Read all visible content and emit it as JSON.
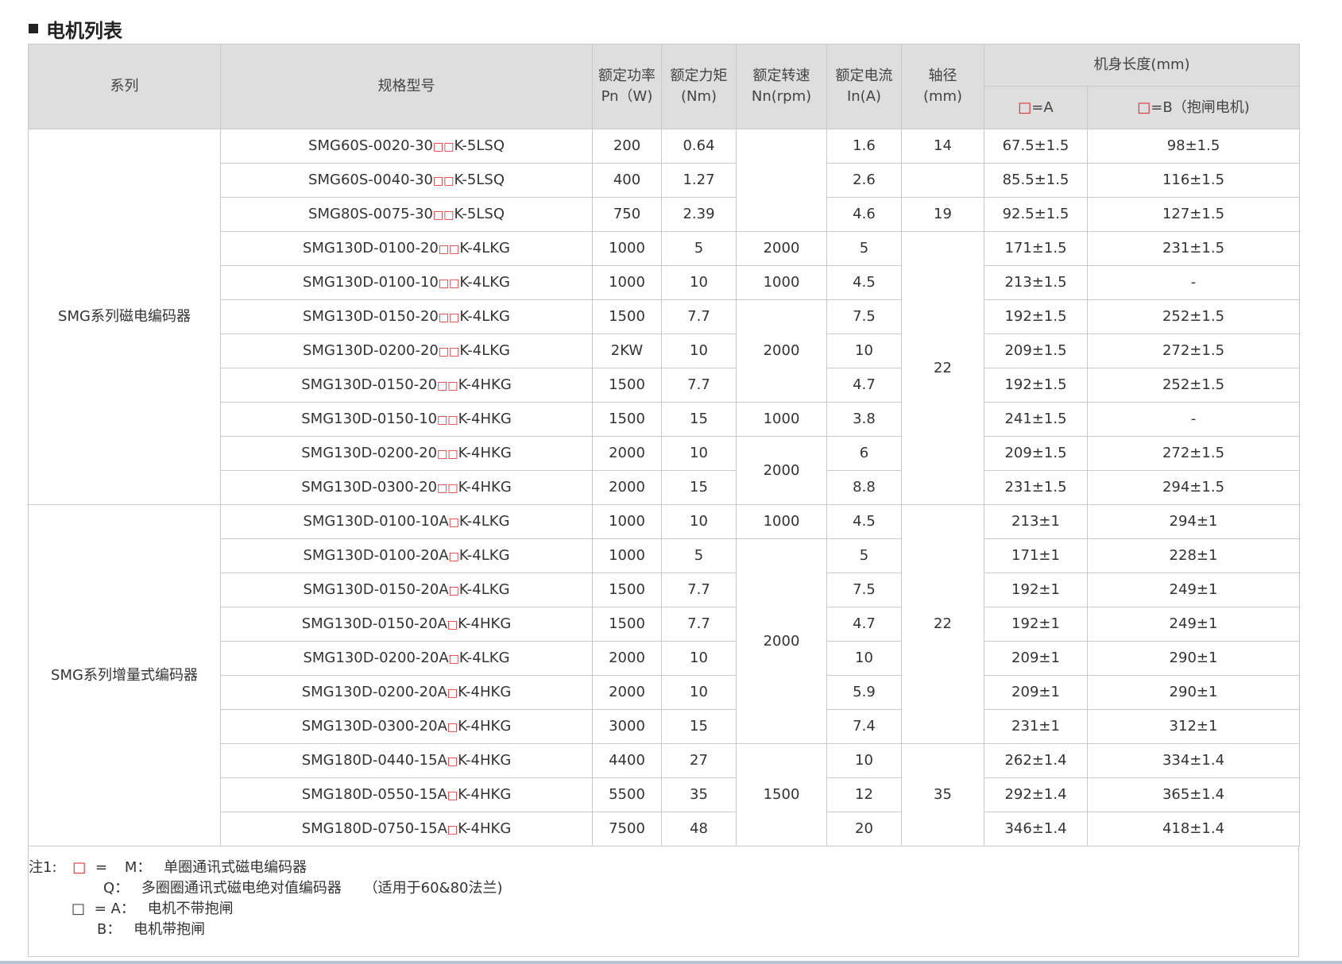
{
  "title": "电机列表",
  "headers": {
    "series": "系列",
    "model": "规格型号",
    "power": [
      "额定功率",
      "Pn（W)"
    ],
    "torque": [
      "额定力矩",
      "(Nm)"
    ],
    "speed": [
      "额定转速",
      "Nn(rpm)"
    ],
    "current": [
      "额定电流",
      "In(A)"
    ],
    "shaft": [
      "轴径",
      "(mm)"
    ],
    "length": "机身长度(mm)",
    "len_a_mark": "□",
    "len_a_label": "=A",
    "len_b_mark": "□",
    "len_b_label": "=B（抱闸电机)"
  },
  "groups": {
    "magnetic": "SMG系列磁电编码器",
    "incremental": "SMG系列增量式编码器"
  },
  "rows": [
    {
      "model": "SMG60S-0020-30□□K-5LSQ",
      "power": "200",
      "torque": "0.64",
      "speed": "",
      "current": "1.6",
      "shaft": "14",
      "len_a": "67.5±1.5",
      "len_b": "98±1.5"
    },
    {
      "model": "SMG60S-0040-30□□K-5LSQ",
      "power": "400",
      "torque": "1.27",
      "speed": "",
      "current": "2.6",
      "shaft": "",
      "len_a": "85.5±1.5",
      "len_b": "116±1.5"
    },
    {
      "model": "SMG80S-0075-30□□K-5LSQ",
      "power": "750",
      "torque": "2.39",
      "speed": "",
      "current": "4.6",
      "shaft": "19",
      "len_a": "92.5±1.5",
      "len_b": "127±1.5"
    },
    {
      "model": "SMG130D-0100-20□□K-4LKG",
      "power": "1000",
      "torque": "5",
      "speed": "2000",
      "current": "5",
      "shaft": "22",
      "len_a": "171±1.5",
      "len_b": "231±1.5"
    },
    {
      "model": "SMG130D-0100-10□□K-4LKG",
      "power": "1000",
      "torque": "10",
      "speed": "1000",
      "current": "4.5",
      "len_a": "213±1.5",
      "len_b": "-"
    },
    {
      "model": "SMG130D-0150-20□□K-4LKG",
      "power": "1500",
      "torque": "7.7",
      "speed": "2000",
      "current": "7.5",
      "len_a": "192±1.5",
      "len_b": "252±1.5"
    },
    {
      "model": "SMG130D-0200-20□□K-4LKG",
      "power": "2KW",
      "torque": "10",
      "current": "10",
      "len_a": "209±1.5",
      "len_b": "272±1.5"
    },
    {
      "model": "SMG130D-0150-20□□K-4HKG",
      "power": "1500",
      "torque": "7.7",
      "current": "4.7",
      "len_a": "192±1.5",
      "len_b": "252±1.5"
    },
    {
      "model": "SMG130D-0150-10□□K-4HKG",
      "power": "1500",
      "torque": "15",
      "speed": "1000",
      "current": "3.8",
      "len_a": "241±1.5",
      "len_b": "-"
    },
    {
      "model": "SMG130D-0200-20□□K-4HKG",
      "power": "2000",
      "torque": "10",
      "speed": "2000",
      "current": "6",
      "len_a": "209±1.5",
      "len_b": "272±1.5"
    },
    {
      "model": "SMG130D-0300-20□□K-4HKG",
      "power": "2000",
      "torque": "15",
      "current": "8.8",
      "len_a": "231±1.5",
      "len_b": "294±1.5"
    },
    {
      "model": "SMG130D-0100-10A□K-4LKG",
      "power": "1000",
      "torque": "10",
      "speed": "1000",
      "current": "4.5",
      "shaft": "22",
      "len_a": "213±1",
      "len_b": "294±1"
    },
    {
      "model": "SMG130D-0100-20A□K-4LKG",
      "power": "1000",
      "torque": "5",
      "speed": "2000",
      "current": "5",
      "len_a": "171±1",
      "len_b": "228±1"
    },
    {
      "model": "SMG130D-0150-20A□K-4LKG",
      "power": "1500",
      "torque": "7.7",
      "current": "7.5",
      "len_a": "192±1",
      "len_b": "249±1"
    },
    {
      "model": "SMG130D-0150-20A□K-4HKG",
      "power": "1500",
      "torque": "7.7",
      "current": "4.7",
      "len_a": "192±1",
      "len_b": "249±1"
    },
    {
      "model": "SMG130D-0200-20A□K-4LKG",
      "power": "2000",
      "torque": "10",
      "current": "10",
      "len_a": "209±1",
      "len_b": "290±1"
    },
    {
      "model": "SMG130D-0200-20A□K-4HKG",
      "power": "2000",
      "torque": "10",
      "current": "5.9",
      "len_a": "209±1",
      "len_b": "290±1"
    },
    {
      "model": "SMG130D-0300-20A□K-4HKG",
      "power": "3000",
      "torque": "15",
      "current": "7.4",
      "len_a": "231±1",
      "len_b": "312±1"
    },
    {
      "model": "SMG180D-0440-15A□K-4HKG",
      "power": "4400",
      "torque": "27",
      "speed": "1500",
      "current": "10",
      "shaft": "35",
      "len_a": "262±1.4",
      "len_b": "334±1.4"
    },
    {
      "model": "SMG180D-0550-15A□K-4HKG",
      "power": "5500",
      "torque": "35",
      "current": "12",
      "len_a": "292±1.4",
      "len_b": "365±1.4"
    },
    {
      "model": "SMG180D-0750-15A□K-4HKG",
      "power": "7500",
      "torque": "48",
      "current": "20",
      "len_a": "346±1.4",
      "len_b": "418±1.4"
    }
  ],
  "notes": {
    "prefix": "注1:",
    "mark_red": "□",
    "eq": "=",
    "m_key": "M：",
    "m_text": "单圈通讯式磁电编码器",
    "q_key": "Q：",
    "q_text": "多圈圈通讯式磁电绝对值编码器",
    "q_extra": "（适用于60&80法兰)",
    "mark_plain": "□",
    "a_key": "= A：",
    "a_text": "电机不带抱闸",
    "b_key": "B：",
    "b_text": "电机带抱闸"
  },
  "colors": {
    "header_bg": "#dedede",
    "border": "#c9c9c9",
    "accent_red": "#e02020",
    "text": "#333333"
  }
}
